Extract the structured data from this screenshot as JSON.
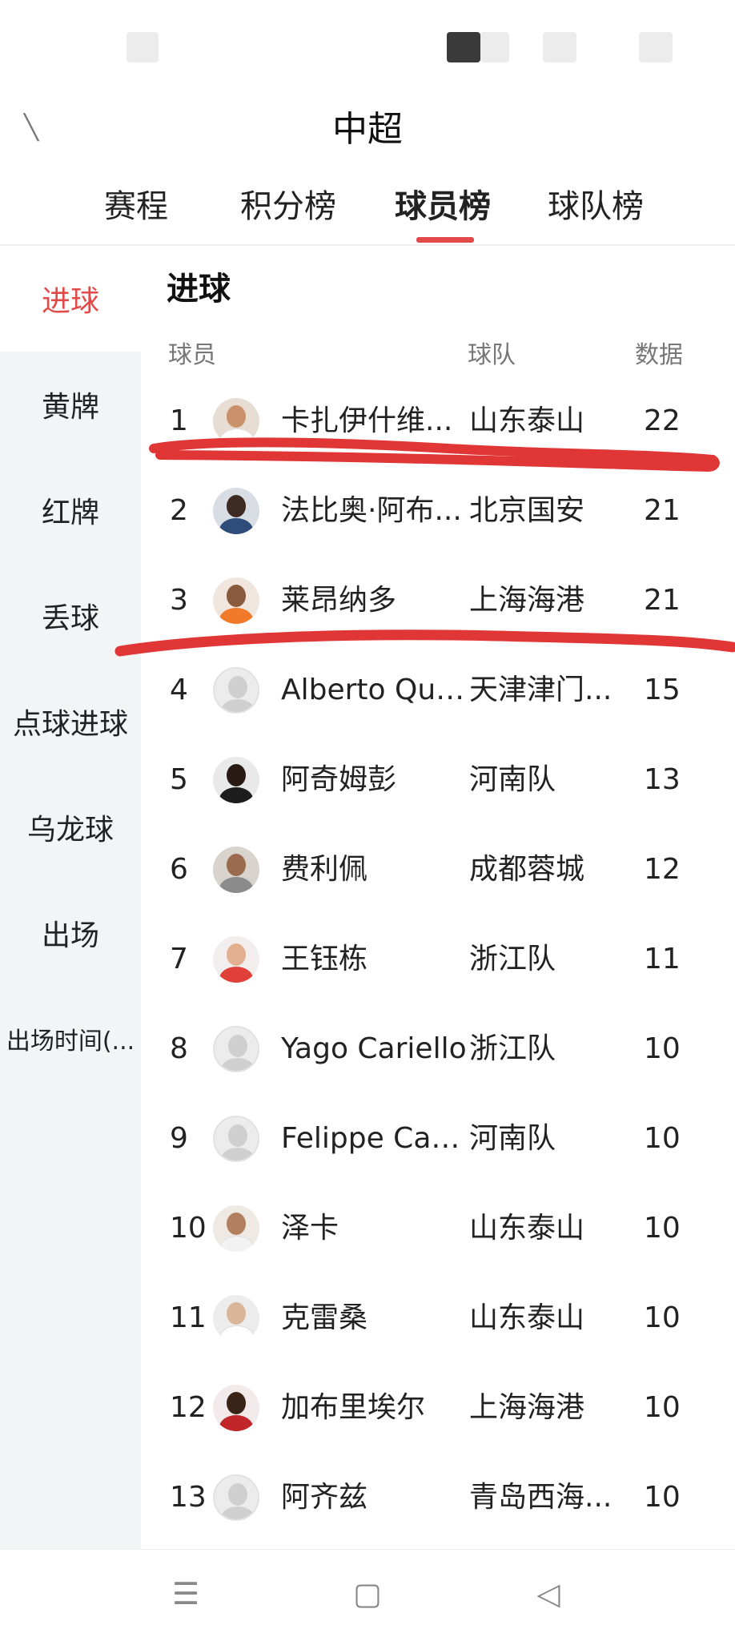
{
  "header": {
    "title": "中超",
    "tabs": [
      {
        "label": "赛程"
      },
      {
        "label": "积分榜"
      },
      {
        "label": "球员榜"
      },
      {
        "label": "球队榜"
      }
    ]
  },
  "sidebar": {
    "items": [
      {
        "label": "进球"
      },
      {
        "label": "黄牌"
      },
      {
        "label": "红牌"
      },
      {
        "label": "丢球"
      },
      {
        "label": "点球进球"
      },
      {
        "label": "乌龙球"
      },
      {
        "label": "出场"
      },
      {
        "label": "出场时间(..."
      }
    ]
  },
  "main": {
    "section_title": "进球",
    "columns": {
      "player": "球员",
      "team": "球队",
      "value": "数据"
    },
    "rows": [
      {
        "rank": "1",
        "name": "卡扎伊什维...",
        "team": "山东泰山",
        "value": "22"
      },
      {
        "rank": "2",
        "name": "法比奥·阿布...",
        "team": "北京国安",
        "value": "21"
      },
      {
        "rank": "3",
        "name": "莱昂纳多",
        "team": "上海海港",
        "value": "21"
      },
      {
        "rank": "4",
        "name": "Alberto Quil...",
        "team": "天津津门...",
        "value": "15"
      },
      {
        "rank": "5",
        "name": "阿奇姆彭",
        "team": "河南队",
        "value": "13"
      },
      {
        "rank": "6",
        "name": "费利佩",
        "team": "成都蓉城",
        "value": "12"
      },
      {
        "rank": "7",
        "name": "王钰栋",
        "team": "浙江队",
        "value": "11"
      },
      {
        "rank": "8",
        "name": "Yago Cariello",
        "team": "浙江队",
        "value": "10"
      },
      {
        "rank": "9",
        "name": "Felippe Car...",
        "team": "河南队",
        "value": "10"
      },
      {
        "rank": "10",
        "name": "泽卡",
        "team": "山东泰山",
        "value": "10"
      },
      {
        "rank": "11",
        "name": "克雷桑",
        "team": "山东泰山",
        "value": "10"
      },
      {
        "rank": "12",
        "name": "加布里埃尔",
        "team": "上海海港",
        "value": "10"
      },
      {
        "rank": "13",
        "name": "阿齐兹",
        "team": "青岛西海...",
        "value": "10"
      }
    ]
  },
  "navbar": {
    "menu_icon": "☰",
    "home_icon": "▢",
    "back_icon": "◁"
  },
  "colors": {
    "accent": "#e24a4a",
    "sidebar_bg": "#f3f4f6",
    "annotation_stroke": "#e03636"
  },
  "icons": {
    "back": "back-arrow-icon",
    "menu": "menu-icon",
    "home": "home-icon",
    "nav_back": "triangle-back-icon"
  }
}
